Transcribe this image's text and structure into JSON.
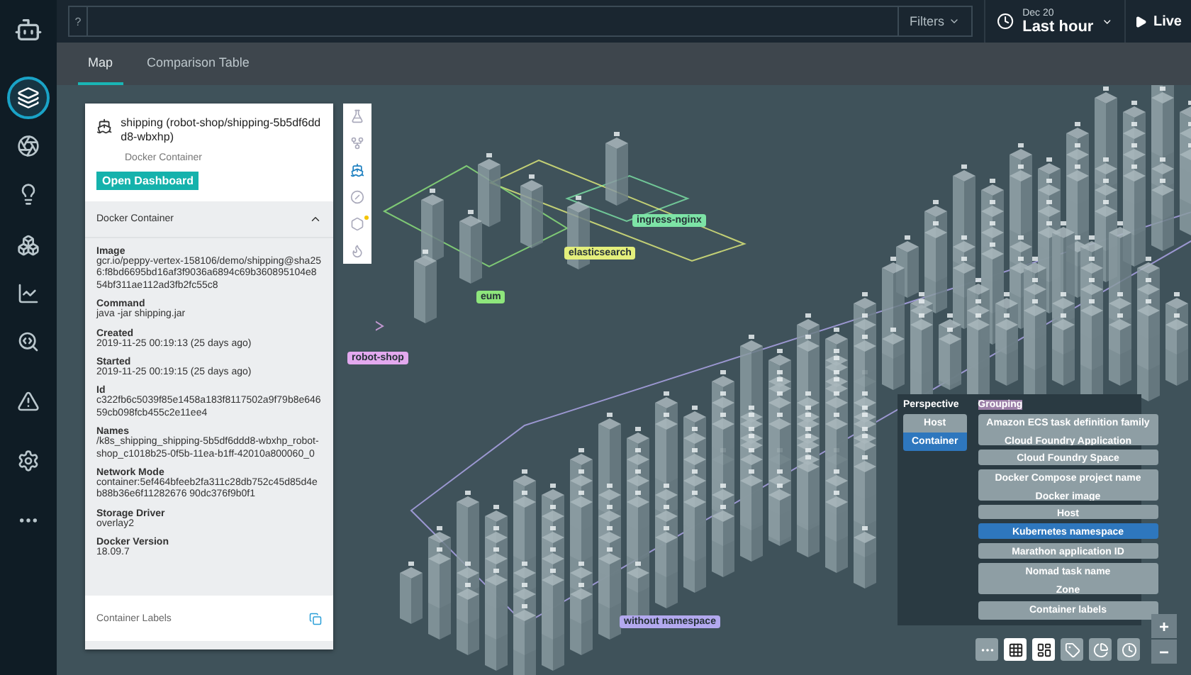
{
  "sidebar": {
    "items": [
      {
        "selected": true
      },
      {
        "selected": false
      },
      {
        "selected": false
      },
      {
        "selected": false
      },
      {
        "selected": false
      },
      {
        "selected": false
      },
      {
        "selected": false
      },
      {
        "selected": false
      },
      {
        "selected": false
      }
    ]
  },
  "top_bar": {
    "help": "?",
    "filters": "Filters",
    "time_date": "Dec 20",
    "time_range": "Last hour",
    "live": "Live"
  },
  "tabs": [
    {
      "label": "Map",
      "selected": true
    },
    {
      "label": "Comparison Table",
      "selected": false
    }
  ],
  "details": {
    "title": "shipping (robot-shop/shipping-5b5df6ddd8-wbxhp)",
    "subtitle": "Docker Container",
    "action": "Open Dashboard",
    "section": {
      "title": "Docker Container",
      "expanded": true
    },
    "fields": [
      {
        "label": "Image",
        "value": "gcr.io/peppy-vertex-158106/demo/shipping@sha256:f8bd6695bd16af3f9036a6894c69b360895104e854bf311ae112ad3fb2fc55c8"
      },
      {
        "label": "Command",
        "value": "java -jar shipping.jar"
      },
      {
        "label": "Created",
        "value": "2019-11-25 00:19:13 (25 days ago)"
      },
      {
        "label": "Started",
        "value": "2019-11-25 00:19:15 (25 days ago)"
      },
      {
        "label": "Id",
        "value": "c322fb6c5039f85e1458a183f8117502a9f79b8e64659cb098fcb455c2e11ee4"
      },
      {
        "label": "Names",
        "value": "/k8s_shipping_shipping-5b5df6ddd8-wbxhp_robot-shop_c1018b25-0f5b-11ea-b1ff-42010a800060_0"
      },
      {
        "label": "Network Mode",
        "value": "container:5ef464bfeeb2fa311c28db752c45d85d4eb88b36e6f11282676 90dc376f9b0f1"
      },
      {
        "label": "Storage Driver",
        "value": "overlay2"
      },
      {
        "label": "Docker Version",
        "value": "18.09.7"
      }
    ],
    "footer": "Container Labels"
  },
  "detail_tools": [
    {
      "selected": false,
      "badge": false
    },
    {
      "selected": false,
      "badge": false
    },
    {
      "selected": true,
      "badge": false
    },
    {
      "selected": false,
      "badge": false
    },
    {
      "selected": false,
      "badge": true
    },
    {
      "selected": false,
      "badge": false
    }
  ],
  "namespaces": [
    {
      "label": "ingress-nginx",
      "color": "#7de3a6"
    },
    {
      "label": "elasticsearch",
      "color": "#e4ef7c"
    },
    {
      "label": "eum",
      "color": "#8ee67c"
    },
    {
      "label": "robot-shop",
      "color": "#e3a9ef"
    },
    {
      "label": "without namespace",
      "color": "#b3a9ef"
    }
  ],
  "perspective": {
    "title": "Perspective",
    "options": [
      {
        "label": "Host",
        "selected": false
      },
      {
        "label": "Container",
        "selected": true
      }
    ],
    "grouping_title": "Grouping",
    "groups": [
      [
        {
          "label": "Amazon ECS task definition family",
          "selected": false
        },
        {
          "label": "Cloud Foundry Application",
          "selected": false
        }
      ],
      [
        {
          "label": "Cloud Foundry Space",
          "selected": false
        }
      ],
      [
        {
          "label": "Docker Compose project name",
          "selected": false
        },
        {
          "label": "Docker image",
          "selected": false
        }
      ],
      [
        {
          "label": "Host",
          "selected": false
        }
      ],
      [
        {
          "label": "Kubernetes namespace",
          "selected": true
        }
      ],
      [
        {
          "label": "Marathon application ID",
          "selected": false
        }
      ],
      [
        {
          "label": "Nomad task name",
          "selected": false
        },
        {
          "label": "Zone",
          "selected": false
        }
      ]
    ],
    "labels_button": "Container labels"
  },
  "view_tools": [
    {
      "selected": false
    },
    {
      "selected": true
    },
    {
      "selected": true
    },
    {
      "selected": false
    },
    {
      "selected": false
    },
    {
      "selected": false
    }
  ],
  "zoom": {
    "in": "+",
    "out": "−"
  }
}
